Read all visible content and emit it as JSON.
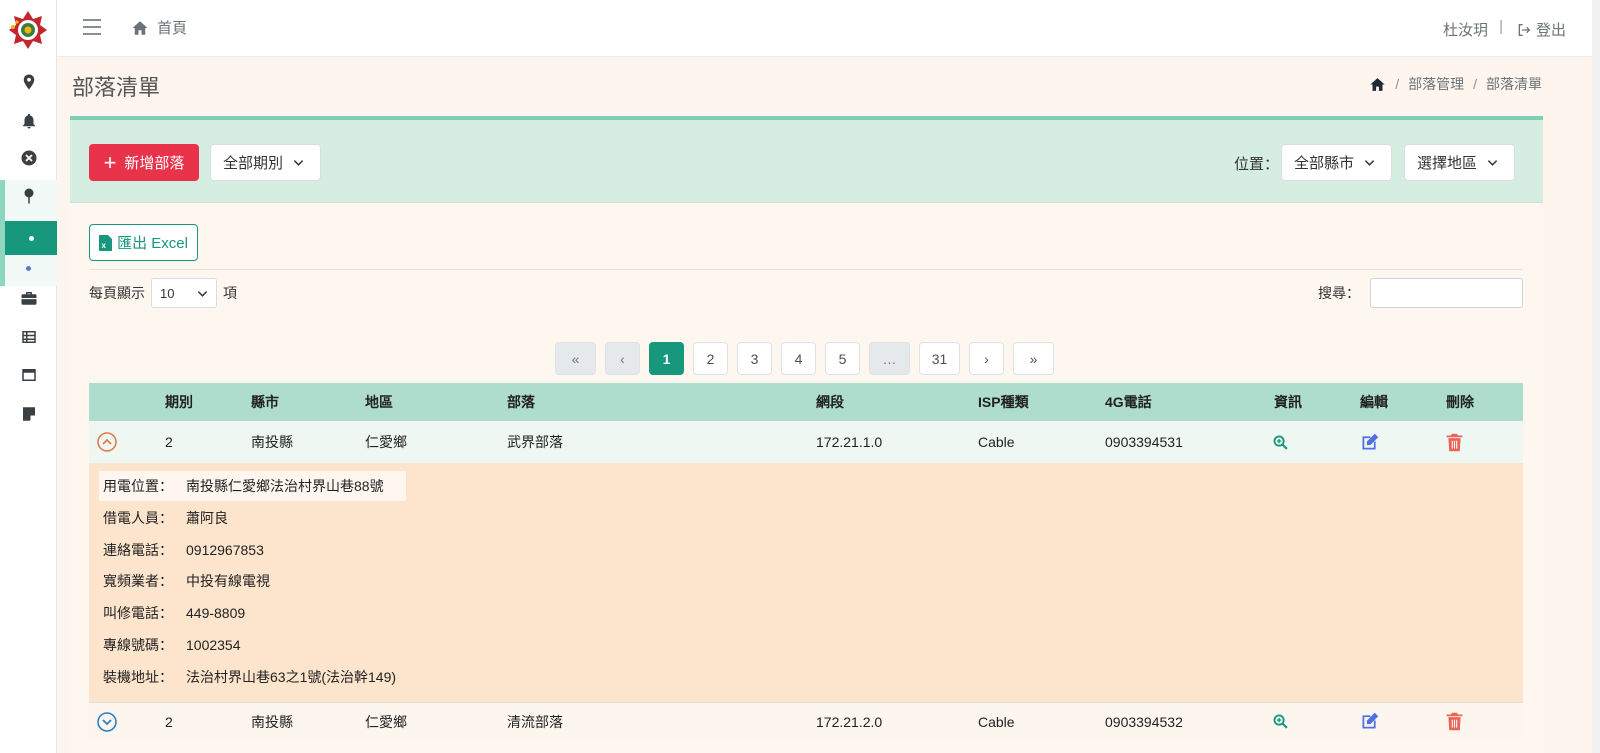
{
  "topbar": {
    "home_label": "首頁",
    "user_name": "杜汝玥",
    "separator": "|",
    "logout_label": "登出"
  },
  "page": {
    "title": "部落清單",
    "breadcrumb": [
      "部落管理",
      "部落清單"
    ]
  },
  "toolbar": {
    "add_label": "新增部落",
    "period_select": "全部期別",
    "location_label": "位置：",
    "county_select": "全部縣市",
    "region_select": "選擇地區",
    "export_label": "匯出 Excel"
  },
  "table_controls": {
    "page_len_prefix": "每頁顯示",
    "page_len_value": "10",
    "page_len_suffix": "項",
    "search_label": "搜尋："
  },
  "pagination": {
    "first": "«",
    "prev": "‹",
    "pages": [
      "1",
      "2",
      "3",
      "4",
      "5"
    ],
    "ellipsis": "…",
    "last_page": "31",
    "next": "›",
    "last": "»",
    "current": "1"
  },
  "table": {
    "headers": [
      "期別",
      "縣市",
      "地區",
      "部落",
      "網段",
      "ISP種類",
      "4G電話",
      "資訊",
      "編輯",
      "刪除"
    ],
    "rows": [
      {
        "period": "2",
        "county": "南投縣",
        "district": "仁愛鄉",
        "tribe": "武界部落",
        "subnet": "172.21.1.0",
        "isp": "Cable",
        "phone4g": "0903394531",
        "expanded": true
      },
      {
        "period": "2",
        "county": "南投縣",
        "district": "仁愛鄉",
        "tribe": "清流部落",
        "subnet": "172.21.2.0",
        "isp": "Cable",
        "phone4g": "0903394532",
        "expanded": false
      }
    ]
  },
  "detail": {
    "items": [
      {
        "label": "用電位置：",
        "value": "南投縣仁愛鄉法治村界山巷88號"
      },
      {
        "label": "借電人員：",
        "value": "蕭阿良"
      },
      {
        "label": "連絡電話：",
        "value": "0912967853"
      },
      {
        "label": "寬頻業者：",
        "value": "中投有線電視"
      },
      {
        "label": "叫修電話：",
        "value": "449-8809"
      },
      {
        "label": "專線號碼：",
        "value": "1002354"
      },
      {
        "label": "裝機地址：",
        "value": "法治村界山巷63之1號(法治幹149)"
      }
    ]
  },
  "colors": {
    "primary": "#17977c",
    "danger": "#e9334b",
    "header_band": "#d6eee1",
    "table_head": "#aedccd",
    "detail_bg": "#fde5cd",
    "info_icon": "#17977c",
    "edit_icon": "#4f6fe8",
    "delete_icon": "#e96558"
  },
  "icons": {
    "sidebar": [
      "map-pin-icon",
      "bell-icon",
      "close-circle-icon",
      "pushpin-icon",
      "dot-icon",
      "dot-icon",
      "briefcase-icon",
      "table-icon",
      "browser-window-icon",
      "sticky-note-icon"
    ]
  }
}
